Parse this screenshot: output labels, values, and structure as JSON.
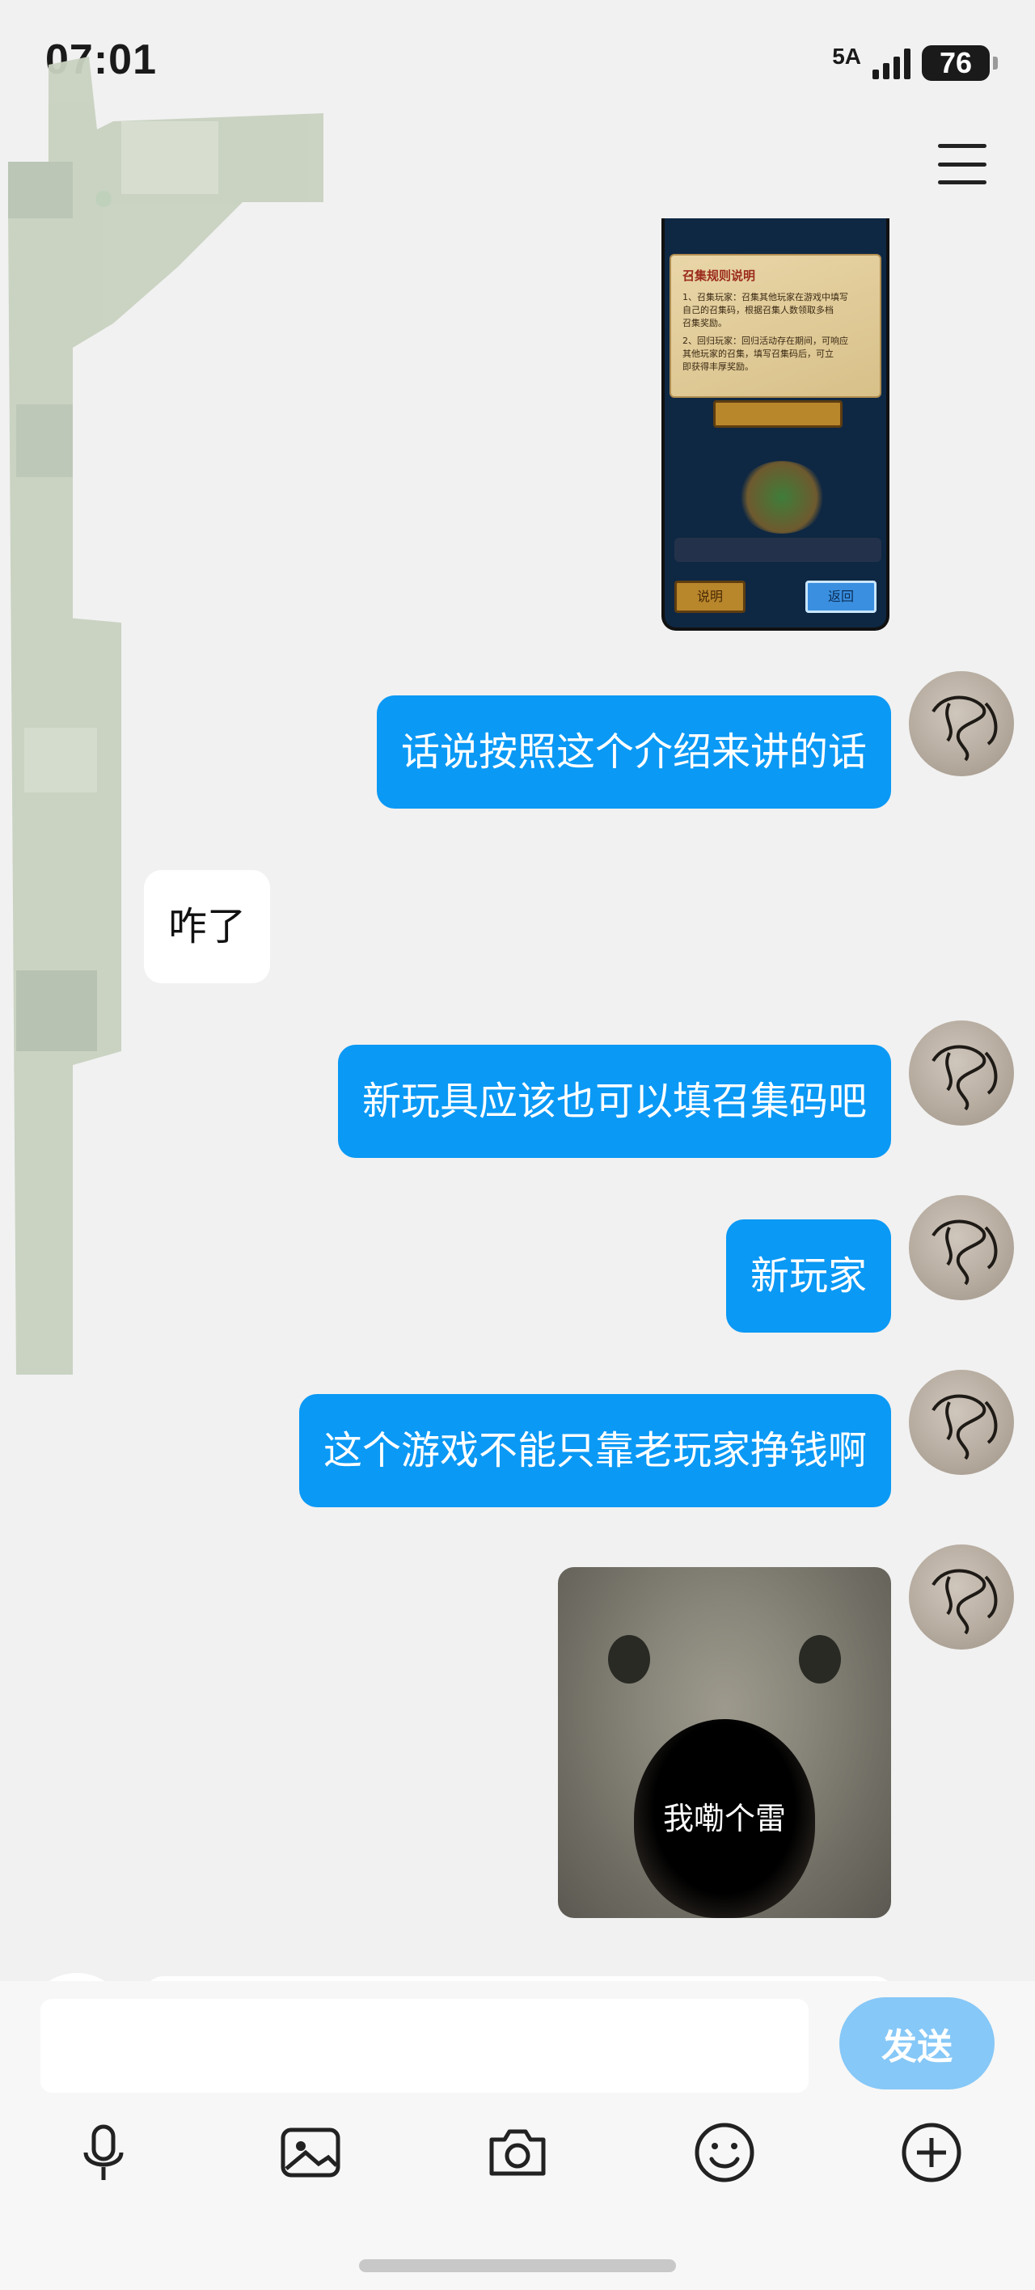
{
  "status_bar": {
    "time": "07:01",
    "network": "5A",
    "battery": "76"
  },
  "header": {
    "menu_icon": "menu-icon",
    "online_status_color": "#27c46a"
  },
  "messages": [
    {
      "type": "image",
      "from": "me",
      "content": "game-screenshot",
      "screenshot": {
        "title": "召集规则说明",
        "lines": [
          "1、召集玩家：召集其他玩家在游戏中填写",
          "自己的召集码，根据召集人数领取多档",
          "召集奖励。",
          "2、回归玩家：回归活动存在期间，可响应",
          "其他玩家的召集，填写召集码后，可立",
          "即获得丰厚奖励。"
        ],
        "left_button": "说明",
        "right_button": "返回"
      }
    },
    {
      "type": "text",
      "from": "me",
      "text": "话说按照这个介绍来讲的话"
    },
    {
      "type": "text",
      "from": "them",
      "text": "咋了"
    },
    {
      "type": "text",
      "from": "me",
      "text": "新玩具应该也可以填召集码吧"
    },
    {
      "type": "text",
      "from": "me",
      "text": "新玩家"
    },
    {
      "type": "text",
      "from": "me",
      "text": "这个游戏不能只靠老玩家挣钱啊"
    },
    {
      "type": "sticker",
      "from": "me",
      "caption": "我嘞个雷"
    }
  ],
  "input": {
    "placeholder": "",
    "value": "",
    "send_label": "发送"
  },
  "toolbar": [
    "microphone-icon",
    "image-icon",
    "camera-icon",
    "emoji-icon",
    "plus-icon"
  ],
  "colors": {
    "outgoing_bubble": "#0a99f5",
    "incoming_bubble": "#ffffff",
    "send_button": "#86c8f7",
    "background": "#f1f1f1"
  }
}
